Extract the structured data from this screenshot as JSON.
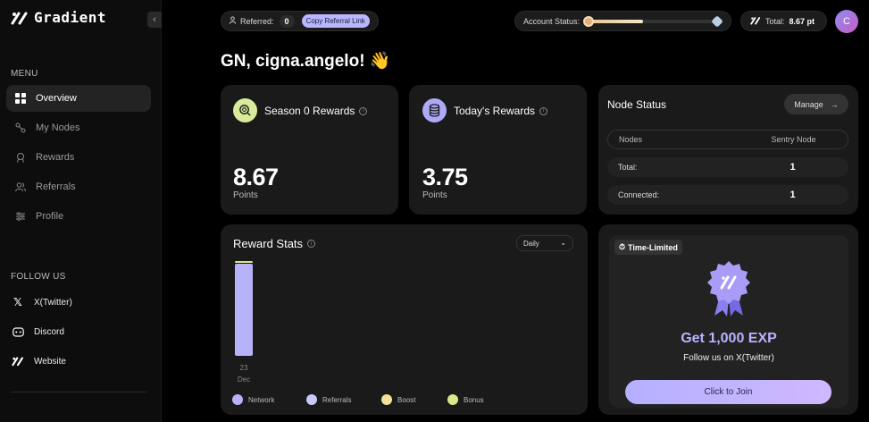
{
  "brand": {
    "name": "Gradient"
  },
  "sidebar": {
    "menu_label": "MENU",
    "items": [
      {
        "label": "Overview",
        "icon": "grid-icon",
        "active": true
      },
      {
        "label": "My Nodes",
        "icon": "nodes-icon"
      },
      {
        "label": "Rewards",
        "icon": "award-icon"
      },
      {
        "label": "Referrals",
        "icon": "users-icon"
      },
      {
        "label": "Profile",
        "icon": "sliders-icon"
      }
    ],
    "follow_label": "FOLLOW US",
    "follow": [
      {
        "label": "X(Twitter)",
        "icon": "x-icon"
      },
      {
        "label": "Discord",
        "icon": "discord-icon"
      },
      {
        "label": "Website",
        "icon": "gradient-logo-icon"
      }
    ]
  },
  "topbar": {
    "referred_label": "Referred:",
    "referred_count": "0",
    "copy_link_label": "Copy Referral Link",
    "account_status_label": "Account Status:",
    "account_status_progress": 0.43,
    "total_label": "Total:",
    "total_value": "8.67 pt",
    "avatar_initial": "C"
  },
  "greeting": "GN, cigna.angelo! 👋",
  "season_rewards": {
    "title": "Season 0 Rewards",
    "value": "8.67",
    "unit": "Points"
  },
  "today_rewards": {
    "title": "Today's Rewards",
    "value": "3.75",
    "unit": "Points"
  },
  "node_status": {
    "title": "Node Status",
    "manage_label": "Manage",
    "headers": [
      "Nodes",
      "Sentry Node"
    ],
    "rows": [
      {
        "label": "Total:",
        "value": "1"
      },
      {
        "label": "Connected:",
        "value": "1"
      }
    ]
  },
  "reward_stats": {
    "title": "Reward Stats",
    "period": "Daily",
    "tick_day": "23",
    "tick_month": "Dec",
    "legend": [
      {
        "name": "Network",
        "color": "#b7b3fa"
      },
      {
        "name": "Referrals",
        "color": "#c7c9f7"
      },
      {
        "name": "Boost",
        "color": "#f3e39a"
      },
      {
        "name": "Bonus",
        "color": "#d8e88a"
      }
    ]
  },
  "chart_data": {
    "type": "bar",
    "categories": [
      "23 Dec"
    ],
    "series": [
      {
        "name": "Network",
        "values": [
          8.5
        ]
      },
      {
        "name": "Referrals",
        "values": [
          0
        ]
      },
      {
        "name": "Boost",
        "values": [
          0
        ]
      },
      {
        "name": "Bonus",
        "values": [
          0.17
        ]
      }
    ],
    "stacked": true
  },
  "promo": {
    "badge": "Time-Limited",
    "title": "Get 1,000 EXP",
    "subtitle": "Follow us on X(Twitter)",
    "button": "Click to Join"
  }
}
